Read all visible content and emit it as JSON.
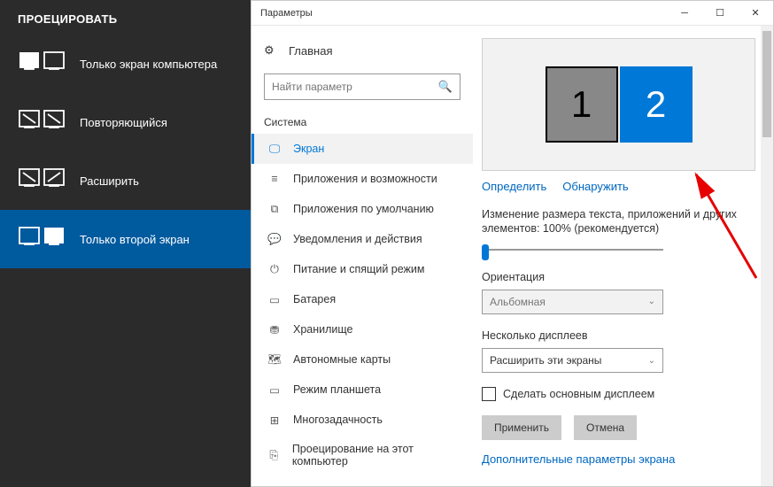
{
  "project_panel": {
    "title": "ПРОЕЦИРОВАТЬ",
    "items": [
      {
        "label": "Только экран компьютера"
      },
      {
        "label": "Повторяющийся"
      },
      {
        "label": "Расширить"
      },
      {
        "label": "Только второй экран"
      }
    ],
    "selected_index": 3
  },
  "settings": {
    "window_title": "Параметры",
    "home_label": "Главная",
    "search_placeholder": "Найти параметр",
    "category_label": "Система",
    "nav": [
      "Экран",
      "Приложения и возможности",
      "Приложения по умолчанию",
      "Уведомления и действия",
      "Питание и спящий режим",
      "Батарея",
      "Хранилище",
      "Автономные карты",
      "Режим планшета",
      "Многозадачность",
      "Проецирование на этот компьютер"
    ],
    "active_nav": 0,
    "displays": [
      "1",
      "2"
    ],
    "identify_label": "Определить",
    "detect_label": "Обнаружить",
    "scale_label": "Изменение размера текста, приложений и других элементов: 100% (рекомендуется)",
    "orientation_label": "Ориентация",
    "orientation_value": "Альбомная",
    "multiple_label": "Несколько дисплеев",
    "multiple_value": "Расширить эти экраны",
    "make_main_label": "Сделать основным дисплеем",
    "apply_label": "Применить",
    "cancel_label": "Отмена",
    "advanced_label": "Дополнительные параметры экрана"
  }
}
